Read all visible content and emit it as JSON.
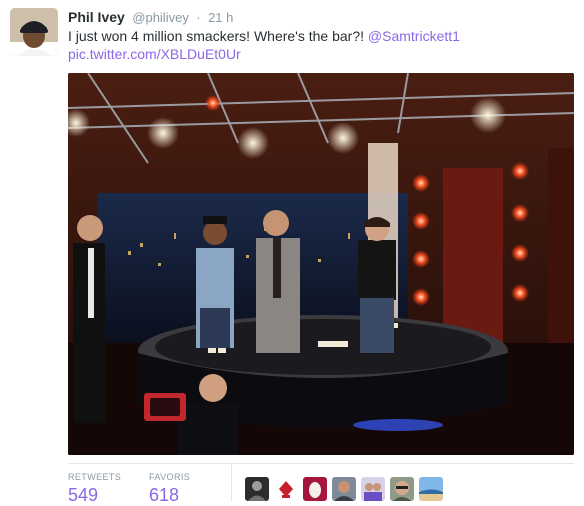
{
  "tweet": {
    "fullname": "Phil Ivey",
    "username": "@philivey",
    "separator": "·",
    "time": "21 h",
    "text_main": "I just won 4 million smackers! Where's the bar?! ",
    "mention": "@Samtrickett1",
    "pic_link": "pic.twitter.com/XBLDuEt0Ur"
  },
  "stats": {
    "retweets_label": "RETWEETS",
    "retweets_value": "549",
    "favorites_label": "FAVORIS",
    "favorites_value": "618"
  },
  "colors": {
    "link": "#8b67e6",
    "secondary": "#8899a6",
    "border": "#e1e8ed"
  },
  "icons": {
    "favoriters": [
      "avatar-person-dark",
      "avatar-poker-logo",
      "avatar-egg",
      "avatar-person",
      "avatar-group",
      "avatar-person-glasses",
      "avatar-landscape"
    ]
  }
}
